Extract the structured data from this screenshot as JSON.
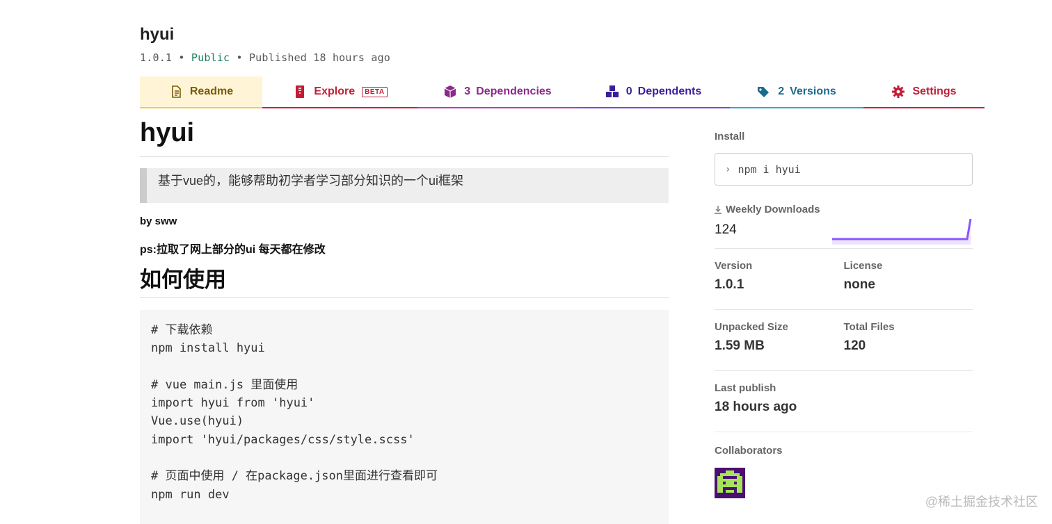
{
  "package": {
    "name": "hyui",
    "version": "1.0.1",
    "sep": "•",
    "visibility": "Public",
    "published": "Published 18 hours ago"
  },
  "tabs": {
    "readme": "Readme",
    "explore": "Explore",
    "beta": "BETA",
    "dependencies_count": "3",
    "dependencies": "Dependencies",
    "dependents_count": "0",
    "dependents": "Dependents",
    "versions_count": "2",
    "versions": "Versions",
    "settings": "Settings"
  },
  "readme": {
    "title": "hyui",
    "quote": "基于vue的，能够帮助初学者学习部分知识的一个ui框架",
    "byline": "by sww",
    "ps": "ps:拉取了网上部分的ui 每天都在修改",
    "heading": "如何使用",
    "code": "# 下载依赖\nnpm install hyui\n\n# vue main.js 里面使用\nimport hyui from 'hyui'\nVue.use(hyui)\nimport 'hyui/packages/css/style.scss'\n\n# 页面中使用 / 在package.json里面进行查看即可\nnpm run dev"
  },
  "sidebar": {
    "install_label": "Install",
    "install_cmd": "npm i hyui",
    "downloads_label": "Weekly Downloads",
    "downloads_value": "124",
    "version_label": "Version",
    "version_value": "1.0.1",
    "license_label": "License",
    "license_value": "none",
    "unpacked_label": "Unpacked Size",
    "unpacked_value": "1.59 MB",
    "files_label": "Total Files",
    "files_value": "120",
    "last_publish_label": "Last publish",
    "last_publish_value": "18 hours ago",
    "collaborators_label": "Collaborators"
  },
  "watermark": "@稀土掘金技术社区",
  "colors": {
    "readme_tab": "#f6c84c",
    "explore_tab": "#cc2241",
    "deps_tab": "#b33fb8",
    "dependents_tab": "#7b48e0",
    "versions_tab": "#33a4d4",
    "settings_tab": "#cc2241",
    "sparkline": "#8956ff"
  },
  "icons": {
    "readme": "document-icon",
    "explore": "flask-icon",
    "dependencies": "box-icon",
    "dependents": "boxes-icon",
    "versions": "tags-icon",
    "settings": "gear-icon",
    "downloads": "download-icon"
  }
}
